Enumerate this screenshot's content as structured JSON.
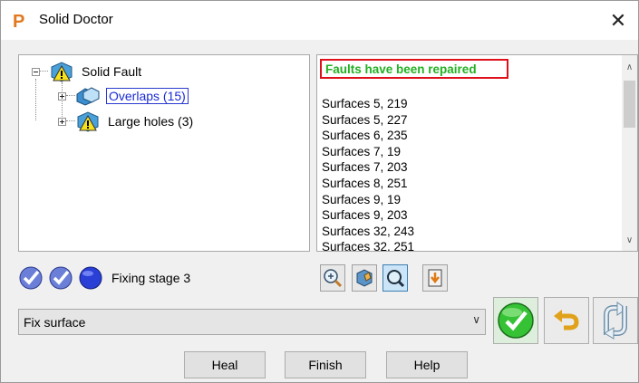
{
  "window": {
    "title": "Solid Doctor",
    "app_icon_letter": "P",
    "close_glyph": "✕",
    "icons": {
      "app": "p-logo-icon",
      "close": "close-icon"
    }
  },
  "tree": {
    "root": {
      "label": "Solid Fault",
      "icon": "warning-solid-icon"
    },
    "children": [
      {
        "label": "Overlaps (15)",
        "icon": "overlap-solid-icon",
        "selected": true
      },
      {
        "label": "Large holes (3)",
        "icon": "warning-solid-icon",
        "selected": false
      }
    ]
  },
  "messages": {
    "status": "Faults have been repaired",
    "status_color": "#22b022",
    "items": [
      "Surfaces 5, 219",
      "Surfaces 5, 227",
      "Surfaces 6, 235",
      "Surfaces 7, 19",
      "Surfaces 7, 203",
      "Surfaces 8, 251",
      "Surfaces 9, 19",
      "Surfaces 9, 203",
      "Surfaces 32, 243",
      "Surfaces 32, 251"
    ],
    "scroll_up_glyph": "∧",
    "scroll_down_glyph": "∨"
  },
  "stages": {
    "label": "Fixing stage 3",
    "steps": [
      {
        "state": "done",
        "icon": "stage-complete-icon"
      },
      {
        "state": "done",
        "icon": "stage-complete-icon"
      },
      {
        "state": "current",
        "icon": "stage-current-icon"
      }
    ]
  },
  "toolbar": {
    "tools": [
      {
        "name": "zoom-in-icon",
        "active": false
      },
      {
        "name": "view-model-icon",
        "active": false
      },
      {
        "name": "magnify-icon",
        "active": true
      },
      {
        "name": "export-list-icon",
        "active": false
      }
    ]
  },
  "fix_action": {
    "selected": "Fix surface",
    "dropdown_glyph": "∨"
  },
  "action_buttons": {
    "accept_icon": "green-check-icon",
    "undo_icon": "undo-arrow-icon",
    "redo_icon": "swap-arrows-icon"
  },
  "buttons": {
    "heal": "Heal",
    "finish": "Finish",
    "help": "Help"
  },
  "colors": {
    "status_border": "#e0101a",
    "selection": "#1a2bd6",
    "accept": "#2fb82f"
  }
}
